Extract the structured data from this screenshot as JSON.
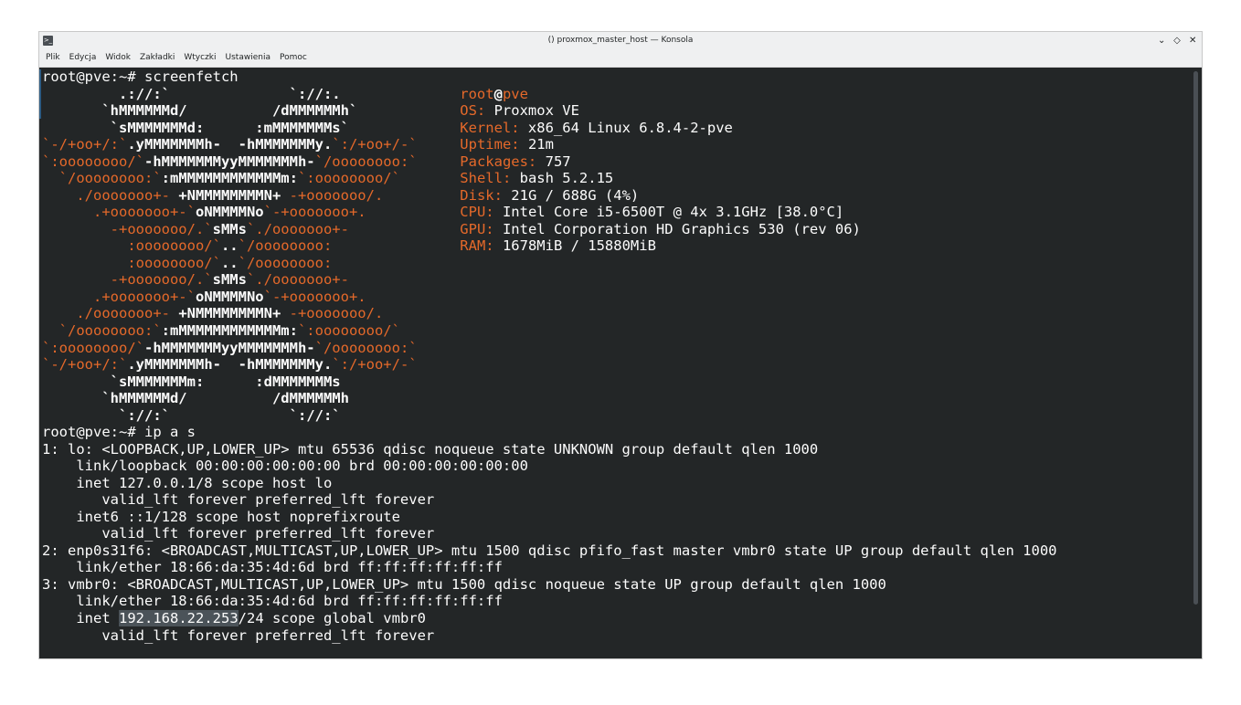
{
  "window": {
    "title": "() proxmox_master_host — Konsola",
    "app_icon": "terminal-icon",
    "controls": [
      "minimize",
      "maximize",
      "close"
    ]
  },
  "menubar": {
    "items": [
      "Plik",
      "Edycja",
      "Widok",
      "Zakładki",
      "Wtyczki",
      "Ustawienia",
      "Pomoc"
    ]
  },
  "terminal": {
    "prompt": "root@pve:~# ",
    "command1": "screenfetch",
    "logo": [
      [
        "",
        "         .://:`              `://:.          "
      ],
      [
        "",
        "       `hMMMMMMd/          /dMMMMMMh`        "
      ],
      [
        "",
        "        `sMMMMMMMd:      :mMMMMMMMs`         "
      ],
      [
        "o",
        "`-/+oo+/:`",
        "w",
        ".yMMMMMMMh-  -hMMMMMMMy.",
        "o",
        "`:/+oo+/-`"
      ],
      [
        "o",
        "`:oooooooo/`",
        "w",
        "-hMMMMMMMyyMMMMMMMh-",
        "o",
        "`/oooooooo:`"
      ],
      [
        "o",
        "  `/oooooooo:`",
        "w",
        ":mMMMMMMMMMMMMm:",
        "o",
        "`:oooooooo/`"
      ],
      [
        "o",
        "    ./ooooooo+- ",
        "w",
        "+NMMMMMMMMN+",
        "o",
        " -+ooooooo/."
      ],
      [
        "o",
        "      .+ooooooo+-`",
        "w",
        "oNMMMMNo",
        "o",
        "`-+ooooooo+."
      ],
      [
        "o",
        "        -+ooooooo/.`",
        "w",
        "sMMs",
        "o",
        "`./ooooooo+-"
      ],
      [
        "o",
        "          :oooooooo/`",
        "w",
        "..",
        "o",
        "`/oooooooo:"
      ],
      [
        "o",
        "          :oooooooo/`",
        "w",
        "..",
        "o",
        "`/oooooooo:"
      ],
      [
        "o",
        "        -+ooooooo/.`",
        "w",
        "sMMs",
        "o",
        "`./ooooooo+-"
      ],
      [
        "o",
        "      .+ooooooo+-`",
        "w",
        "oNMMMMNo",
        "o",
        "`-+ooooooo+."
      ],
      [
        "o",
        "    ./ooooooo+- ",
        "w",
        "+NMMMMMMMMN+",
        "o",
        " -+ooooooo/."
      ],
      [
        "o",
        "  `/oooooooo:`",
        "w",
        ":mMMMMMMMMMMMMm:",
        "o",
        "`:oooooooo/`"
      ],
      [
        "o",
        "`:oooooooo/`",
        "w",
        "-hMMMMMMMyyMMMMMMMh-",
        "o",
        "`/oooooooo:`"
      ],
      [
        "o",
        "`-/+oo+/:`",
        "w",
        ".yMMMMMMMh-  -hMMMMMMMy.",
        "o",
        "`:/+oo+/-`"
      ],
      [
        "",
        "        `sMMMMMMMm:      :dMMMMMMMs          "
      ],
      [
        "",
        "       `hMMMMMMd/          /dMMMMMMh         "
      ],
      [
        "",
        "         `://:`              `://:`          "
      ]
    ],
    "info": {
      "user": "root",
      "at": "@",
      "host": "pve",
      "rows": [
        [
          "OS: ",
          "Proxmox VE"
        ],
        [
          "Kernel: ",
          "x86_64 Linux 6.8.4-2-pve"
        ],
        [
          "Uptime: ",
          "21m"
        ],
        [
          "Packages: ",
          "757"
        ],
        [
          "Shell: ",
          "bash 5.2.15"
        ],
        [
          "Disk: ",
          "21G / 688G (4%)"
        ],
        [
          "CPU: ",
          "Intel Core i5-6500T @ 4x 3.1GHz [38.0°C]"
        ],
        [
          "GPU: ",
          "Intel Corporation HD Graphics 530 (rev 06)"
        ],
        [
          "RAM: ",
          "1678MiB / 15880MiB"
        ]
      ]
    },
    "command2": "ip a s",
    "ip_output_1": "1: lo: <LOOPBACK,UP,LOWER_UP> mtu 65536 qdisc noqueue state UNKNOWN group default qlen 1000\n    link/loopback 00:00:00:00:00:00 brd 00:00:00:00:00:00\n    inet 127.0.0.1/8 scope host lo\n       valid_lft forever preferred_lft forever\n    inet6 ::1/128 scope host noprefixroute\n       valid_lft forever preferred_lft forever\n2: enp0s31f6: <BROADCAST,MULTICAST,UP,LOWER_UP> mtu 1500 qdisc pfifo_fast master vmbr0 state UP group default qlen 1000\n    link/ether 18:66:da:35:4d:6d brd ff:ff:ff:ff:ff:ff\n3: vmbr0: <BROADCAST,MULTICAST,UP,LOWER_UP> mtu 1500 qdisc noqueue state UP group default qlen 1000\n    link/ether 18:66:da:35:4d:6d brd ff:ff:ff:ff:ff:ff\n    inet ",
    "highlighted_ip": "192.168.22.253",
    "ip_output_2": "/24 scope global vmbr0\n       valid_lft forever preferred_lft forever"
  }
}
